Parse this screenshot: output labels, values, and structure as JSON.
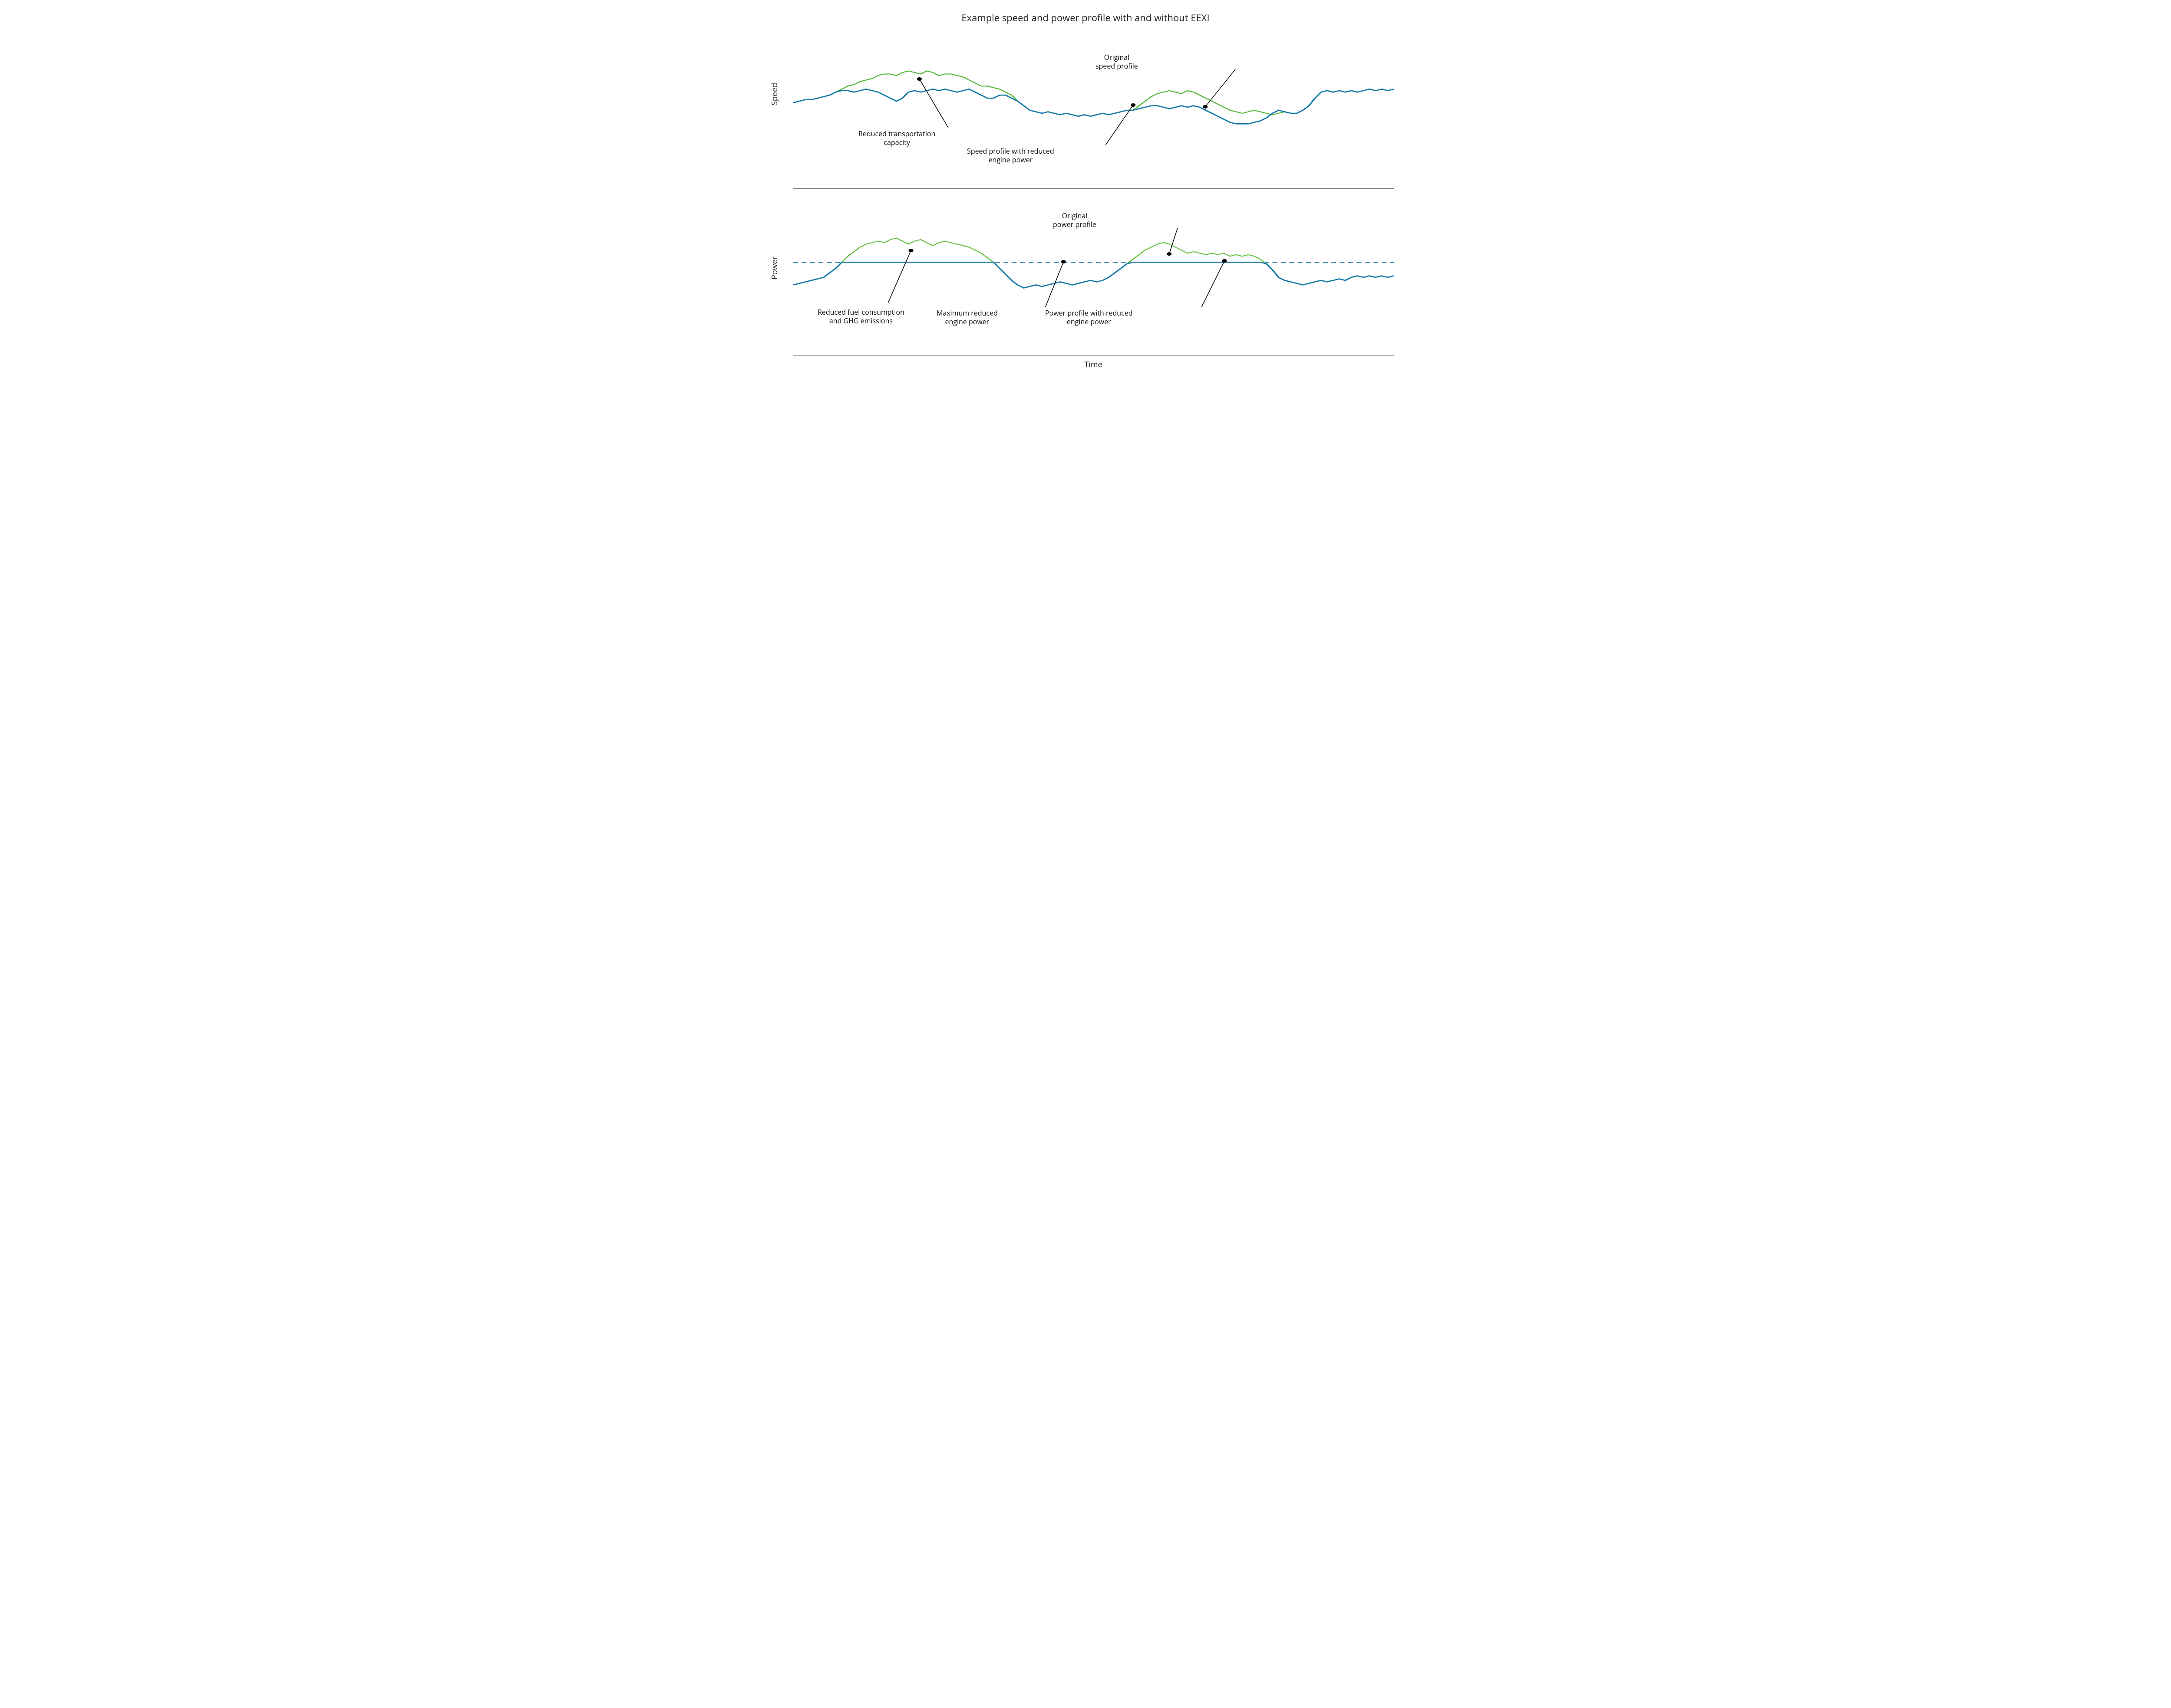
{
  "title": "Example speed and power profile with and without EEXI",
  "axes": {
    "x": "Time",
    "y_top": "Speed",
    "y_bottom": "Power"
  },
  "annotations": {
    "speed_reduced_cap": "Reduced transportation\ncapacity",
    "speed_reduced_profile": "Speed profile with reduced\nengine power",
    "speed_original": "Original\nspeed profile",
    "power_reduced_fuel": "Reduced fuel consumption\nand GHG emissions",
    "power_max_reduced": "Maximum reduced\nengine power",
    "power_reduced_profile": "Power profile with reduced\nengine power",
    "power_original": "Original\npower profile"
  },
  "colors": {
    "original": "#53b837",
    "reduced": "#1277a8",
    "axis": "#6e6e6e"
  },
  "chart_data": [
    {
      "type": "line",
      "title": "Speed profile",
      "xlabel": "Time",
      "ylabel": "Speed",
      "ylim": [
        0,
        100
      ],
      "series": [
        {
          "name": "Original speed profile",
          "y": [
            55,
            56,
            57,
            57,
            58,
            59,
            60,
            62,
            64,
            66,
            67,
            69,
            70,
            71,
            73,
            74,
            74,
            73,
            75,
            76,
            75,
            74,
            76,
            75,
            73,
            74,
            74,
            73,
            72,
            70,
            68,
            66,
            66,
            65,
            64,
            62,
            60,
            56,
            53,
            50,
            49,
            48,
            49,
            48,
            47,
            48,
            47,
            46,
            47,
            46,
            47,
            48,
            47,
            48,
            49,
            50,
            50,
            53,
            56,
            59,
            61,
            62,
            63,
            62,
            61,
            63,
            62,
            60,
            58,
            56,
            54,
            52,
            50,
            49,
            48,
            49,
            50,
            49,
            48,
            47,
            48,
            49,
            48,
            48,
            50,
            53,
            58,
            62,
            63,
            62,
            63,
            62,
            63,
            62,
            63,
            64,
            63,
            64,
            63,
            64
          ]
        },
        {
          "name": "Speed profile with reduced engine power",
          "y": [
            55,
            56,
            57,
            57,
            58,
            59,
            60,
            62,
            63,
            63,
            62,
            63,
            64,
            63,
            62,
            60,
            58,
            56,
            58,
            62,
            63,
            62,
            63,
            64,
            63,
            64,
            63,
            62,
            63,
            64,
            62,
            60,
            58,
            58,
            60,
            60,
            58,
            56,
            53,
            50,
            49,
            48,
            49,
            48,
            47,
            48,
            47,
            46,
            47,
            46,
            47,
            48,
            47,
            48,
            49,
            50,
            50,
            51,
            52,
            53,
            53,
            52,
            51,
            52,
            53,
            52,
            53,
            52,
            50,
            48,
            46,
            44,
            42,
            41,
            41,
            41,
            42,
            43,
            45,
            48,
            50,
            49,
            48,
            48,
            50,
            53,
            58,
            62,
            63,
            62,
            63,
            62,
            63,
            62,
            63,
            64,
            63,
            64,
            63,
            64
          ]
        }
      ]
    },
    {
      "type": "line",
      "title": "Power profile",
      "xlabel": "Time",
      "ylabel": "Power",
      "ylim": [
        0,
        100
      ],
      "power_cap": 60,
      "series": [
        {
          "name": "Original power profile",
          "y": [
            45,
            46,
            47,
            48,
            49,
            50,
            53,
            56,
            60,
            64,
            67,
            70,
            72,
            73,
            74,
            73,
            75,
            76,
            74,
            72,
            74,
            75,
            73,
            71,
            73,
            74,
            73,
            72,
            71,
            70,
            68,
            66,
            63,
            60,
            56,
            52,
            48,
            45,
            43,
            44,
            45,
            44,
            45,
            46,
            47,
            46,
            45,
            46,
            47,
            48,
            47,
            48,
            50,
            53,
            56,
            59,
            62,
            65,
            68,
            70,
            72,
            73,
            72,
            70,
            68,
            66,
            67,
            66,
            65,
            66,
            65,
            66,
            64,
            65,
            64,
            65,
            64,
            62,
            59,
            55,
            50,
            48,
            47,
            46,
            45,
            46,
            47,
            48,
            47,
            48,
            49,
            48,
            50,
            51,
            50,
            51,
            50,
            51,
            50,
            51
          ]
        },
        {
          "name": "Power profile with reduced engine power",
          "y": [
            45,
            46,
            47,
            48,
            49,
            50,
            53,
            56,
            60,
            60,
            60,
            60,
            60,
            60,
            60,
            60,
            60,
            60,
            60,
            60,
            60,
            60,
            60,
            60,
            60,
            60,
            60,
            60,
            60,
            60,
            60,
            60,
            60,
            60,
            56,
            52,
            48,
            45,
            43,
            44,
            45,
            44,
            45,
            46,
            47,
            46,
            45,
            46,
            47,
            48,
            47,
            48,
            50,
            53,
            56,
            59,
            60,
            60,
            60,
            60,
            60,
            60,
            60,
            60,
            60,
            60,
            60,
            60,
            60,
            60,
            60,
            60,
            60,
            60,
            60,
            60,
            60,
            60,
            59,
            55,
            50,
            48,
            47,
            46,
            45,
            46,
            47,
            48,
            47,
            48,
            49,
            48,
            50,
            51,
            50,
            51,
            50,
            51,
            50,
            51
          ]
        },
        {
          "name": "Maximum reduced engine power",
          "y_constant": 60
        }
      ]
    }
  ]
}
